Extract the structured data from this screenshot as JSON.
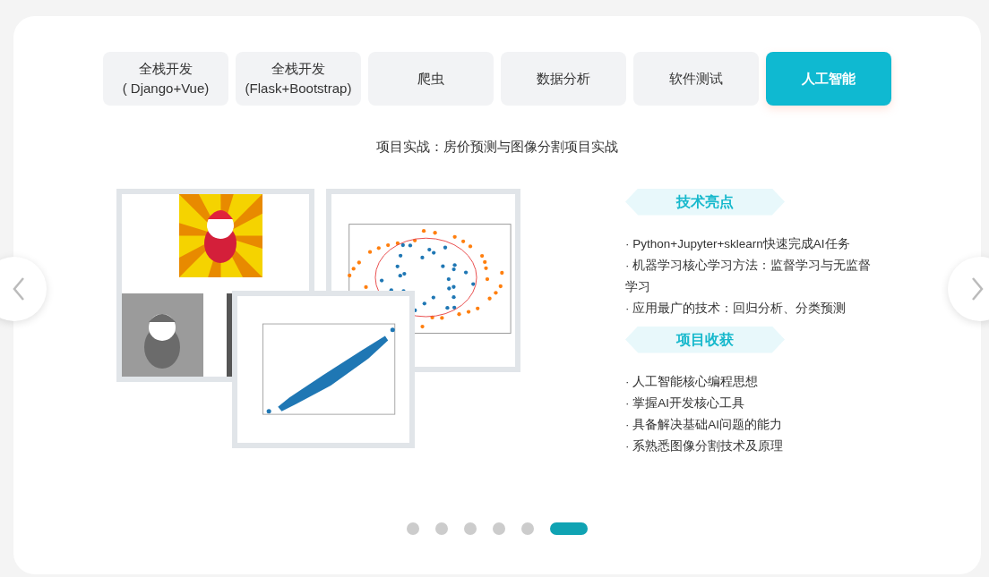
{
  "tabs": [
    {
      "lines": [
        "全栈开发",
        "( Django+Vue)"
      ],
      "selected": false
    },
    {
      "lines": [
        "全栈开发",
        "(Flask+Bootstrap)"
      ],
      "selected": false
    },
    {
      "lines": [
        "爬虫"
      ],
      "selected": false
    },
    {
      "lines": [
        "数据分析"
      ],
      "selected": false
    },
    {
      "lines": [
        "软件测试"
      ],
      "selected": false
    },
    {
      "lines": [
        "人工智能"
      ],
      "selected": true
    }
  ],
  "subtitle": "项目实战：房价预测与图像分割项目实战",
  "sections": [
    {
      "title": "技术亮点",
      "items": [
        "· Python+Jupyter+sklearn快速完成AI任务",
        "· 机器学习核心学习方法：监督学习与无监督学习",
        "· 应用最广的技术：回归分析、分类预测"
      ]
    },
    {
      "title": "项目收获",
      "items": [
        "· 人工智能核心编程思想",
        "· 掌握AI开发核心工具",
        "· 具备解决基础AI问题的能力",
        "· 系熟悉图像分割技术及原理"
      ]
    }
  ],
  "dots": [
    {
      "selected": false
    },
    {
      "selected": false
    },
    {
      "selected": false
    },
    {
      "selected": false
    },
    {
      "selected": false
    },
    {
      "selected": true
    }
  ]
}
